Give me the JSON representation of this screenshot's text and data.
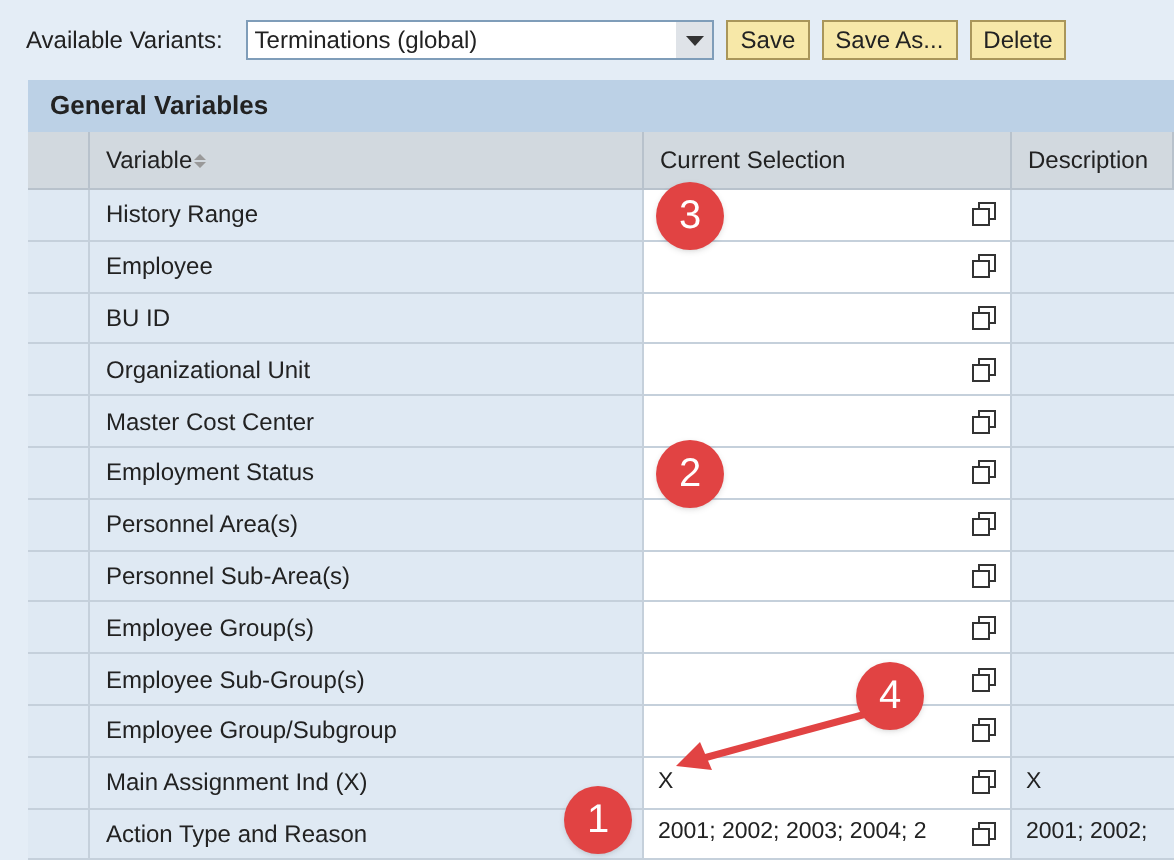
{
  "toolbar": {
    "label": "Available Variants:",
    "variant": "Terminations (global)",
    "buttons": [
      "Save",
      "Save As...",
      "Delete"
    ]
  },
  "panel": {
    "title": "General Variables",
    "columns": [
      "Variable",
      "Current Selection",
      "Description"
    ],
    "rows": [
      {
        "variable": "History Range",
        "selection": "",
        "description": ""
      },
      {
        "variable": "Employee",
        "selection": "",
        "description": ""
      },
      {
        "variable": "BU ID",
        "selection": "",
        "description": ""
      },
      {
        "variable": "Organizational Unit",
        "selection": "",
        "description": ""
      },
      {
        "variable": "Master Cost Center",
        "selection": "",
        "description": ""
      },
      {
        "variable": "Employment Status",
        "selection": "",
        "description": ""
      },
      {
        "variable": "Personnel Area(s)",
        "selection": "",
        "description": ""
      },
      {
        "variable": "Personnel Sub-Area(s)",
        "selection": "",
        "description": ""
      },
      {
        "variable": "Employee Group(s)",
        "selection": "",
        "description": ""
      },
      {
        "variable": "Employee Sub-Group(s)",
        "selection": "",
        "description": ""
      },
      {
        "variable": "Employee Group/Subgroup",
        "selection": "",
        "description": ""
      },
      {
        "variable": "Main Assignment Ind (X)",
        "selection": "X",
        "description": "X"
      },
      {
        "variable": "Action Type and Reason",
        "selection": "2001; 2002; 2003; 2004; 2",
        "description": "2001; 2002;"
      }
    ]
  },
  "callouts": [
    {
      "label": "3",
      "arrow": false
    },
    {
      "label": "2",
      "arrow": false
    },
    {
      "label": "4",
      "arrow": true
    },
    {
      "label": "1",
      "arrow": false
    }
  ]
}
